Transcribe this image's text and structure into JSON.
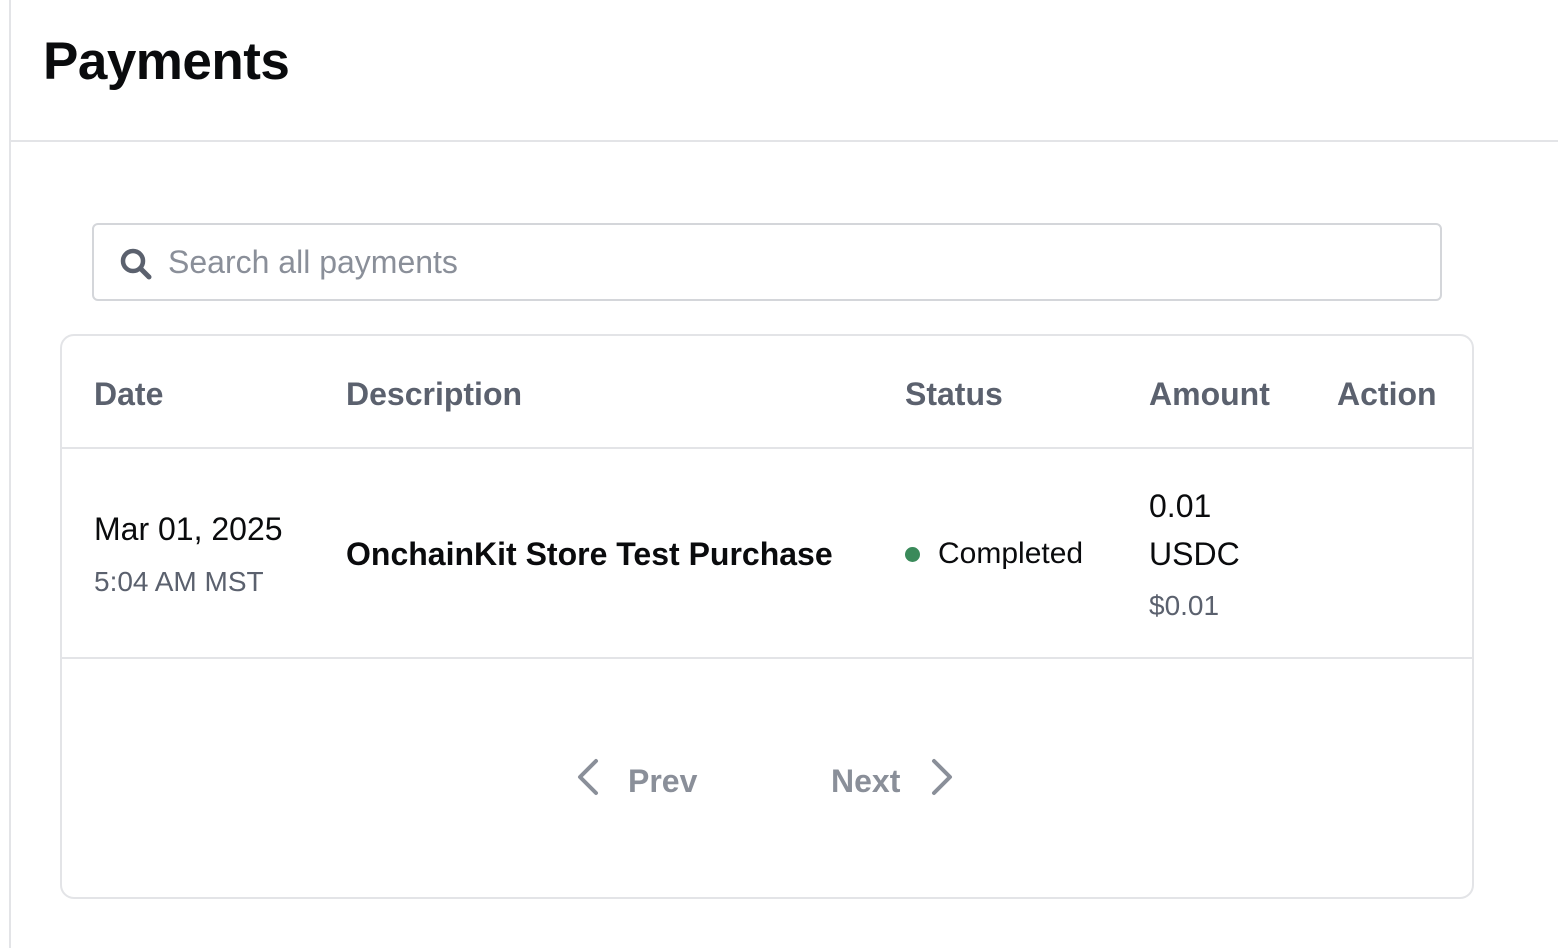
{
  "header": {
    "title": "Payments"
  },
  "search": {
    "placeholder": "Search all payments",
    "value": "",
    "icon": "search-icon"
  },
  "table": {
    "columns": [
      "Date",
      "Description",
      "Status",
      "Amount",
      "Action"
    ],
    "rows": [
      {
        "date": "Mar 01, 2025",
        "time": "5:04 AM MST",
        "description": "OnchainKit Store Test Purchase",
        "status": "Completed",
        "status_color": "#3a8a5a",
        "amount": "0.01",
        "currency": "USDC",
        "fiat_amount": "$0.01",
        "action": ""
      }
    ]
  },
  "pagination": {
    "prev_label": "Prev",
    "next_label": "Next",
    "prev_icon": "chevron-left-icon",
    "next_icon": "chevron-right-icon"
  }
}
